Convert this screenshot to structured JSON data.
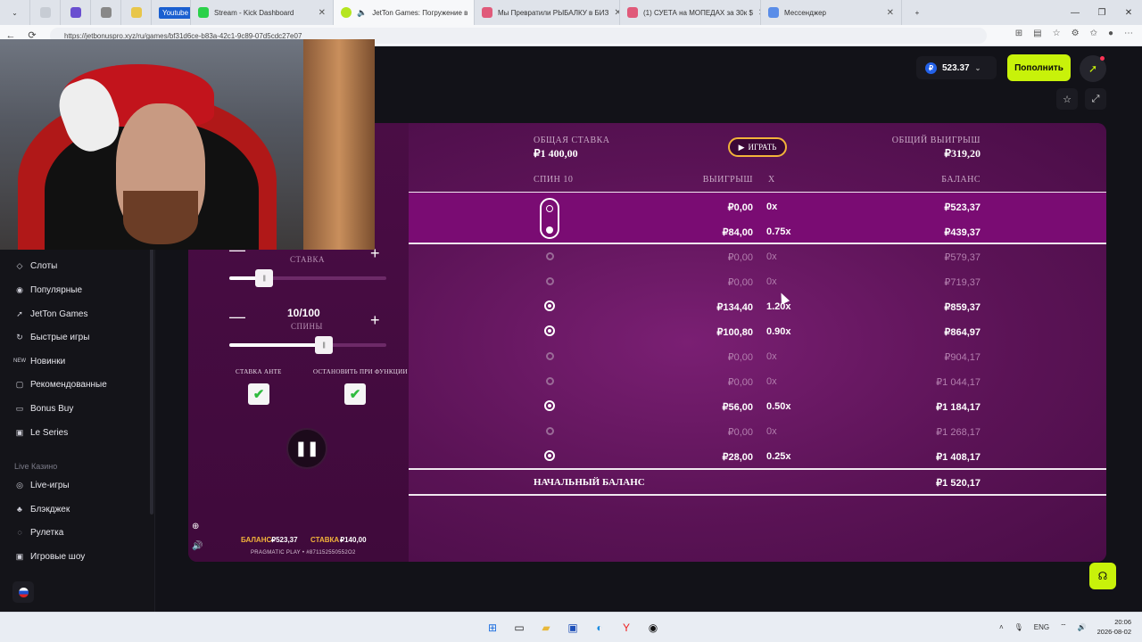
{
  "browser": {
    "tabs": [
      {
        "label": "",
        "active": false
      },
      {
        "label": "",
        "active": false
      },
      {
        "label": "",
        "active": false
      },
      {
        "label": "",
        "active": false
      },
      {
        "label": "",
        "active": false
      },
      {
        "label": "Youtube",
        "active": false
      },
      {
        "label": "Stream - Kick Dashboard",
        "active": false
      },
      {
        "label": "JetTon Games: Погружение в",
        "active": true
      },
      {
        "label": "Мы Превратили РЫБАЛКУ в БИЗ",
        "active": false
      },
      {
        "label": "(1) СУЕТА на МОПЕДАХ за 30к $",
        "active": false
      },
      {
        "label": "Мессенджер",
        "active": false
      }
    ],
    "url": "https://jetbonuspro.xyz/ru/games/bf31d6ce-b83a-42c1-9c89-07d5cdc27e07"
  },
  "site": {
    "balance": "523.37",
    "currency_symbol": "₽",
    "deposit_label": "Пополнить",
    "nav": [
      {
        "label": "Слоты",
        "icon": "slots-icon"
      },
      {
        "label": "Популярные",
        "icon": "popular-icon"
      },
      {
        "label": "JetTon Games",
        "icon": "jetton-icon"
      },
      {
        "label": "Быстрые игры",
        "icon": "fast-games-icon"
      },
      {
        "label": "Новинки",
        "icon": "new-icon"
      },
      {
        "label": "Рекомендованные",
        "icon": "recommended-icon"
      },
      {
        "label": "Bonus Buy",
        "icon": "bonus-buy-icon"
      },
      {
        "label": "Le Series",
        "icon": "le-series-icon"
      }
    ],
    "live_section": "Live Казино",
    "live_nav": [
      {
        "label": "Live-игры",
        "icon": "live-games-icon"
      },
      {
        "label": "Блэкджек",
        "icon": "blackjack-icon"
      },
      {
        "label": "Рулетка",
        "icon": "roulette-icon"
      },
      {
        "label": "Игровые шоу",
        "icon": "game-shows-icon"
      }
    ]
  },
  "game": {
    "total_bet_label": "ОБЩАЯ СТАВКА",
    "total_bet_value": "₽1 400,00",
    "play_label": "ИГРАТЬ",
    "total_win_label": "ОБЩИЙ ВЫИГРЫШ",
    "total_win_value": "₽319,20",
    "col_spin": "СПИН 10",
    "col_win": "ВЫИГРЫШ",
    "col_mult": "X",
    "col_balance": "БАЛАНС",
    "rows": [
      {
        "win": "₽0,00",
        "mult": "0x",
        "balance": "₽523,37",
        "state": "current"
      },
      {
        "win": "₽84,00",
        "mult": "0.75x",
        "balance": "₽439,37",
        "state": "current"
      },
      {
        "win": "₽0,00",
        "mult": "0x",
        "balance": "₽579,37",
        "state": "dim"
      },
      {
        "win": "₽0,00",
        "mult": "0x",
        "balance": "₽719,37",
        "state": "dim"
      },
      {
        "win": "₽134,40",
        "mult": "1.20x",
        "balance": "₽859,37",
        "state": "bright"
      },
      {
        "win": "₽100,80",
        "mult": "0.90x",
        "balance": "₽864,97",
        "state": "bright"
      },
      {
        "win": "₽0,00",
        "mult": "0x",
        "balance": "₽904,17",
        "state": "dim"
      },
      {
        "win": "₽0,00",
        "mult": "0x",
        "balance": "₽1 044,17",
        "state": "dim"
      },
      {
        "win": "₽56,00",
        "mult": "0.50x",
        "balance": "₽1 184,17",
        "state": "bright"
      },
      {
        "win": "₽0,00",
        "mult": "0x",
        "balance": "₽1 268,17",
        "state": "dim"
      },
      {
        "win": "₽28,00",
        "mult": "0.25x",
        "balance": "₽1 408,17",
        "state": "bright"
      }
    ],
    "start_balance_label": "НАЧАЛЬНЫЙ БАЛАНС",
    "start_balance_value": "₽1 520,17",
    "stake_label": "СТАВКА",
    "stake_value": "₽140,00",
    "stake_slider_fraction": 0.22,
    "spins_value": "10/100",
    "spins_label": "СПИНЫ",
    "spins_slider_fraction": 0.6,
    "ante_label": "СТАВКА АНТЕ",
    "stop_label": "ОСТАНОВИТЬ ПРИ ФУНКЦИИ",
    "footer_balance_label": "БАЛАНС",
    "footer_balance_value": "₽523,37",
    "footer_stake_label": "СТАВКА",
    "footer_stake_value": "₽140,00",
    "provider": "PRAGMATIC PLAY • #871152550552O2"
  },
  "taskbar": {
    "lang": "ENG",
    "time": "20:06",
    "date": "2026-08-02"
  }
}
